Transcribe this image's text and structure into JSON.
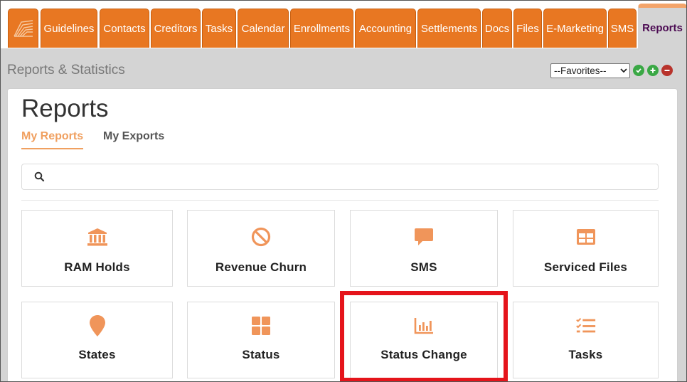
{
  "tabs": [
    {
      "label": "Guidelines"
    },
    {
      "label": "Contacts"
    },
    {
      "label": "Creditors"
    },
    {
      "label": "Tasks"
    },
    {
      "label": "Calendar"
    },
    {
      "label": "Enrollments"
    },
    {
      "label": "Accounting"
    },
    {
      "label": "Settlements"
    },
    {
      "label": "Docs"
    },
    {
      "label": "Files"
    },
    {
      "label": "E-Marketing"
    },
    {
      "label": "SMS"
    },
    {
      "label": "Reports"
    }
  ],
  "header": {
    "section_title": "Reports & Statistics",
    "favorites_value": "--Favorites--"
  },
  "page": {
    "title": "Reports",
    "subtabs": [
      {
        "label": "My Reports"
      },
      {
        "label": "My Exports"
      }
    ],
    "search_placeholder": ""
  },
  "cards": [
    {
      "label": "RAM Holds",
      "icon": "bank-icon"
    },
    {
      "label": "Revenue Churn",
      "icon": "ban-icon"
    },
    {
      "label": "SMS",
      "icon": "speech-bubble-icon"
    },
    {
      "label": "Serviced Files",
      "icon": "table-icon"
    },
    {
      "label": "States",
      "icon": "map-pin-icon"
    },
    {
      "label": "Status",
      "icon": "grid-icon"
    },
    {
      "label": "Status Change",
      "icon": "bar-chart-icon"
    },
    {
      "label": "Tasks",
      "icon": "checklist-icon"
    }
  ],
  "colors": {
    "accent": "#e87722",
    "icon": "#f0955a",
    "highlight": "#e5141b",
    "active_tab_text": "#4b0a52"
  }
}
